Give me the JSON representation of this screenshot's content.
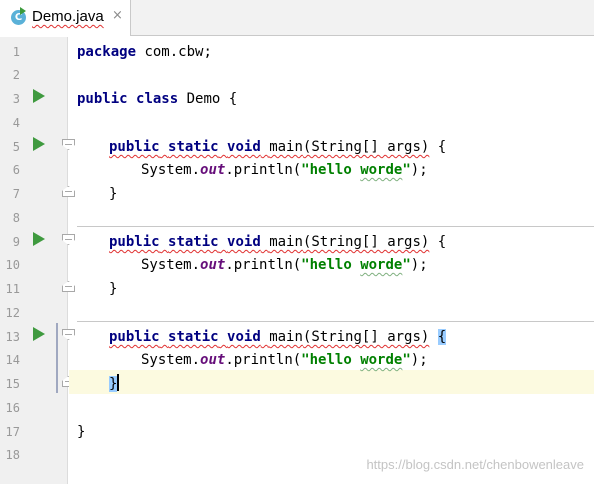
{
  "tab": {
    "label": "Demo.java",
    "icon_letter": "C",
    "close": "×"
  },
  "gutter": {
    "line_numbers": [
      "1",
      "2",
      "3",
      "4",
      "5",
      "6",
      "7",
      "8",
      "9",
      "10",
      "11",
      "12",
      "13",
      "14",
      "15",
      "16",
      "17",
      "18"
    ]
  },
  "icons": {
    "run": "run-gutter-icon",
    "fold": "fold-marker-icon",
    "file": "java-class-icon",
    "close": "close-icon"
  },
  "code": {
    "l1": {
      "kw": "package",
      "rest": " com.cbw;"
    },
    "l3": {
      "kw1": "public",
      "kw2": "class",
      "rest": " Demo {"
    },
    "m5": {
      "kw1": "public",
      "kw2": "static",
      "kw3": "void",
      "method": "main",
      "params": "(String[] args)",
      "brace": "{"
    },
    "l6": {
      "prefix": "System.",
      "field": "out",
      "call": ".println(",
      "q1": "\"",
      "s1": "hello",
      "s2": "worde",
      "q2": "\"",
      "end": ");"
    },
    "close_brace": "}",
    "l17": "}"
  },
  "colors": {
    "keyword": "#000080",
    "string": "#008000",
    "field": "#660e7a",
    "current_line": "#fcfae0",
    "run_icon": "#3f9a3f"
  },
  "watermark": "https://blog.csdn.net/chenbowenleave"
}
